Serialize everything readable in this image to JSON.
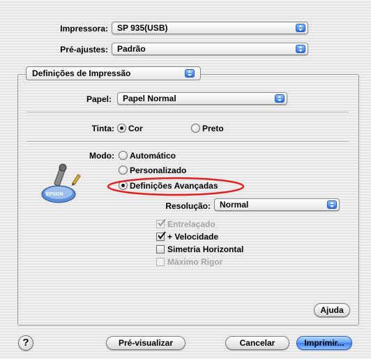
{
  "printer": {
    "label": "Impressora:",
    "value": "SP 935(USB)"
  },
  "presets": {
    "label": "Pré-ajustes:",
    "value": "Padrão"
  },
  "section_popup": {
    "value": "Definições de Impressão"
  },
  "paper": {
    "label": "Papel:",
    "value": "Papel Normal"
  },
  "ink": {
    "label": "Tinta:",
    "options": [
      "Cor",
      "Preto"
    ],
    "selected": "Cor"
  },
  "mode": {
    "label": "Modo:",
    "options": [
      "Automático",
      "Personalizado",
      "Definições Avançadas"
    ],
    "selected": "Definições Avançadas",
    "highlight_color": "#e02020"
  },
  "resolution": {
    "label": "Resolução:",
    "value": "Normal"
  },
  "checkboxes": [
    {
      "label": "Entrelaçado",
      "checked": true,
      "enabled": false
    },
    {
      "label": "+ Velocidade",
      "checked": true,
      "enabled": true
    },
    {
      "label": "Simetria Horizontal",
      "checked": false,
      "enabled": true
    },
    {
      "label": "Máximo Rigor",
      "checked": false,
      "enabled": false
    }
  ],
  "help_button": {
    "label": "Ajuda"
  },
  "footer": {
    "help_icon": "?",
    "preview_label": "Pré-visualizar",
    "cancel_label": "Cancelar",
    "print_label": "Imprimir..."
  },
  "mode_icon": {
    "name": "epson-mode-icon",
    "text": "EPSON"
  },
  "colors": {
    "accent": "#3a80ee",
    "highlight": "#e02020"
  }
}
